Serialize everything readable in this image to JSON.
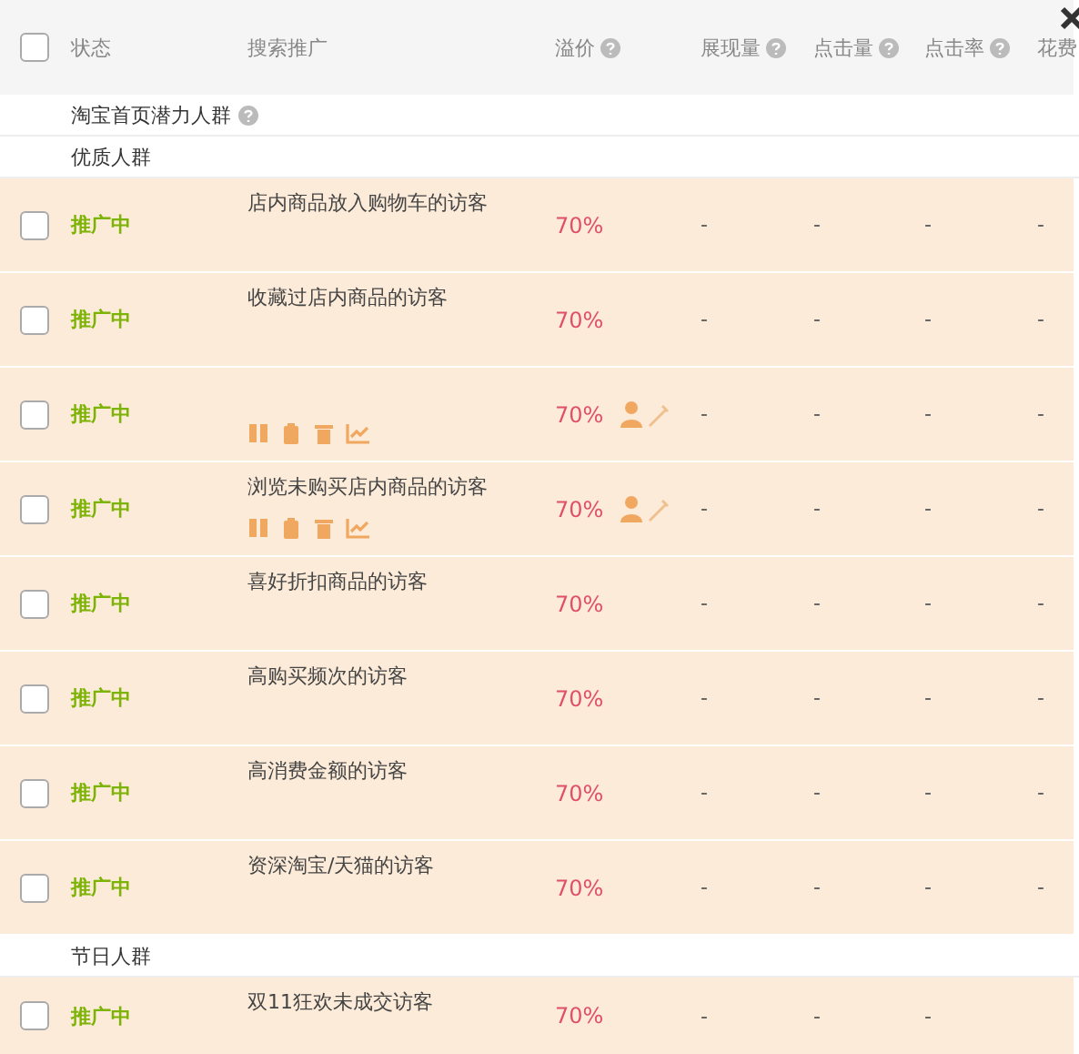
{
  "header": {
    "select_all_checked": false,
    "columns": [
      {
        "label": "状态",
        "help": false
      },
      {
        "label": "搜索推广",
        "help": false
      },
      {
        "label": "溢价",
        "help": true
      },
      {
        "label": "展现量",
        "help": true
      },
      {
        "label": "点击量",
        "help": true
      },
      {
        "label": "点击率",
        "help": true
      },
      {
        "label": "花费"
      }
    ]
  },
  "items": [
    {
      "kind": "group",
      "label": "淘宝首页潜力人群",
      "help": true
    },
    {
      "kind": "group",
      "label": "优质人群",
      "help": false
    },
    {
      "kind": "row",
      "checked": false,
      "status": "推广中",
      "name": "店内商品放入购物车的访客",
      "premium": "70%",
      "actions": false,
      "metrics": [
        "-",
        "-",
        "-",
        "-"
      ]
    },
    {
      "kind": "row",
      "checked": false,
      "status": "推广中",
      "name": "收藏过店内商品的访客",
      "premium": "70%",
      "actions": false,
      "metrics": [
        "-",
        "-",
        "-",
        "-"
      ]
    },
    {
      "kind": "row",
      "checked": false,
      "status": "推广中",
      "premium": "70%",
      "actions": true,
      "metrics": [
        "-",
        "-",
        "-",
        "-"
      ]
    },
    {
      "kind": "row",
      "checked": false,
      "status": "推广中",
      "name": "浏览未购买店内商品的访客",
      "premium": "70%",
      "actions": true,
      "metrics": [
        "-",
        "-",
        "-",
        "-"
      ]
    },
    {
      "kind": "row",
      "checked": false,
      "status": "推广中",
      "name": "喜好折扣商品的访客",
      "premium": "70%",
      "actions": false,
      "metrics": [
        "-",
        "-",
        "-",
        "-"
      ]
    },
    {
      "kind": "row",
      "checked": false,
      "status": "推广中",
      "name": "高购买频次的访客",
      "premium": "70%",
      "actions": false,
      "metrics": [
        "-",
        "-",
        "-",
        "-"
      ]
    },
    {
      "kind": "row",
      "checked": false,
      "status": "推广中",
      "name": "高消费金额的访客",
      "premium": "70%",
      "actions": false,
      "metrics": [
        "-",
        "-",
        "-",
        "-"
      ]
    },
    {
      "kind": "row",
      "checked": false,
      "status": "推广中",
      "name": "资深淘宝/天猫的访客",
      "premium": "70%",
      "actions": false,
      "metrics": [
        "-",
        "-",
        "-",
        "-"
      ]
    },
    {
      "kind": "group",
      "label": "节日人群",
      "help": false
    },
    {
      "kind": "row",
      "checked": false,
      "status": "推广中",
      "name": "双11狂欢未成交访客",
      "premium": "70%",
      "actions": false,
      "metrics": [
        "-",
        "-",
        "-"
      ]
    }
  ]
}
